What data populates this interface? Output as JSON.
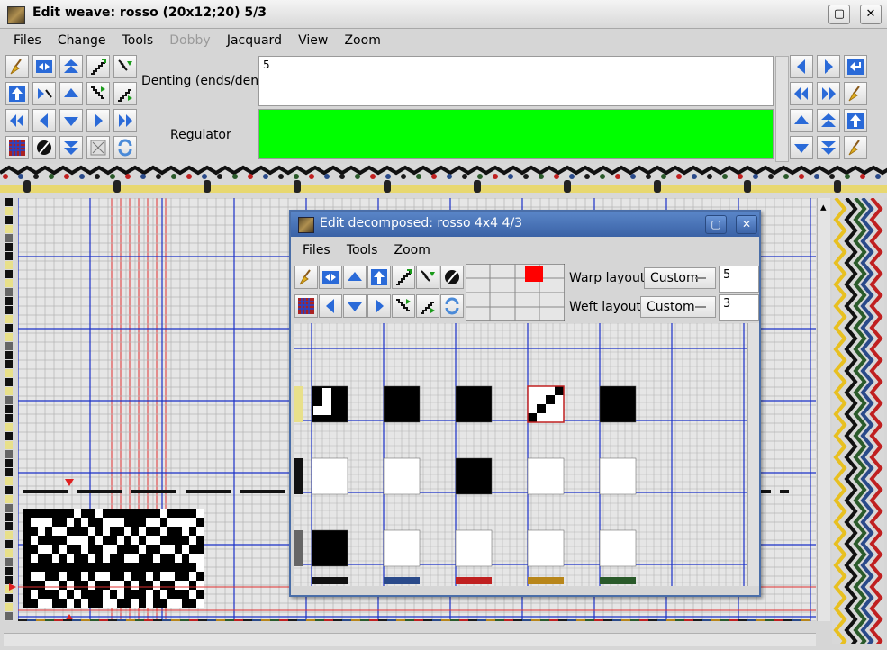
{
  "window": {
    "title": "Edit weave: rosso (20x12;20) 5/3",
    "minimize_label": "▢",
    "close_label": "✕"
  },
  "menu": [
    {
      "label": "Files",
      "enabled": true
    },
    {
      "label": "Change",
      "enabled": true
    },
    {
      "label": "Tools",
      "enabled": true
    },
    {
      "label": "Dobby",
      "enabled": false
    },
    {
      "label": "Jacquard",
      "enabled": true
    },
    {
      "label": "View",
      "enabled": true
    },
    {
      "label": "Zoom",
      "enabled": true
    }
  ],
  "denting": {
    "label": "Denting (ends/dent)",
    "value": "5"
  },
  "regulator": {
    "label": "Regulator",
    "value": "",
    "color": "#00ff00"
  },
  "dialog": {
    "title": "Edit decomposed: rosso 4x4 4/3",
    "menu": [
      "Files",
      "Tools",
      "Zoom"
    ],
    "warp_layout": {
      "label": "Warp layout",
      "mode": "Custom",
      "value": "5"
    },
    "weft_layout": {
      "label": "Weft layout",
      "mode": "Custom",
      "value": "3"
    },
    "maximize_label": "▢",
    "close_label": "✕"
  },
  "colors": {
    "accent": "#3a62a6",
    "grid_line": "#b4b4b4",
    "major_line": "#1a30c8",
    "red_line": "#e03030",
    "regulator": "#00ff00"
  },
  "icons": [
    "broom-icon",
    "swap-icon",
    "up-arrow-icon",
    "stairs-icon",
    "shift-icon",
    "zero-icon",
    "random-icon",
    "refresh-icon"
  ]
}
